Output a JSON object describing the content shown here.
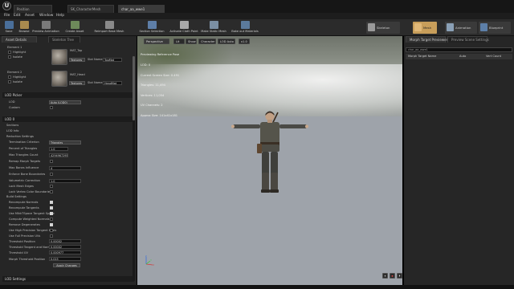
{
  "titlebar": {
    "logo": "U",
    "tabs": [
      "Position",
      "SK_CharacterMesh",
      "char_aa_wwe1"
    ]
  },
  "menu": [
    "File",
    "Edit",
    "Asset",
    "Window",
    "Help"
  ],
  "toolbar": {
    "buttons": [
      "Save",
      "Browse",
      "Preview Animation",
      "Create Asset",
      "Reimport Base Mesh",
      "Section Selection",
      "Activate Cloth Paint",
      "Make Static Mesh",
      "Bake out Materials"
    ],
    "modes": [
      "Skeleton",
      "Mesh",
      "Animation",
      "Blueprint"
    ]
  },
  "left_panel": {
    "tabs": [
      "Asset Details",
      "Skeleton Tree"
    ],
    "element1": {
      "label": "Element 1",
      "material": "MAT_Top",
      "dropdown": "Textures",
      "slot_label": "Slot Name",
      "slot_value": "TopMat",
      "highlight": "Highlight",
      "isolate": "Isolate"
    },
    "element2": {
      "label": "Element 2",
      "material": "MAT_Head",
      "dropdown": "Textures",
      "slot_label": "Slot Name",
      "slot_value": "HeadMat",
      "highlight": "Highlight",
      "isolate": "Isolate"
    },
    "lod_picker": {
      "title": "LOD Picker",
      "lod_label": "LOD",
      "lod_value": "Auto (LOD0)",
      "custom_label": "Custom"
    },
    "lod0": {
      "title": "LOD 0",
      "sections": "Sections",
      "lod_info": "LOD Info"
    },
    "reduction": {
      "title": "Reduction Settings",
      "rows": [
        {
          "label": "Termination Criterion",
          "value": "Triangles"
        },
        {
          "label": "Percent of Triangles",
          "value": "1.0"
        },
        {
          "label": "Max Triangles Count",
          "value": "4294967295"
        },
        {
          "label": "Remap Morph Targets",
          "value": ""
        },
        {
          "label": "Max Bones Influence",
          "value": "4"
        },
        {
          "label": "Enforce Bone Boundaries",
          "value": ""
        },
        {
          "label": "Volumetric Correction",
          "value": "1.0"
        },
        {
          "label": "Lock Mesh Edges",
          "value": ""
        },
        {
          "label": "Lock Vertex Color Boundaries",
          "value": ""
        }
      ]
    },
    "build": {
      "title": "Build Settings",
      "checkbox_rows": [
        "Recompute Normals",
        "Recompute Tangents",
        "Use MikkTSpace Tangent Space",
        "Compute Weighted Normals",
        "Remove Degenerates",
        "Use High Precision Tangent Basis",
        "Use Full Precision UVs"
      ],
      "value_rows": [
        {
          "label": "Threshold Position",
          "value": "0.00002"
        },
        {
          "label": "Threshold Tangent and Normal",
          "value": "0.00002"
        },
        {
          "label": "Threshold UV",
          "value": "0.000977"
        },
        {
          "label": "Morph Threshold Position",
          "value": "0.015"
        }
      ],
      "apply_button": "Apply Changes"
    },
    "lod_settings": "LOD Settings"
  },
  "viewport": {
    "buttons": [
      "Perspective",
      "Lit",
      "Show",
      "Character",
      "LOD Auto",
      "x1.0"
    ],
    "stats": [
      "Previewing Reference Pose",
      "LOD: 0",
      "Current Screen Size: 0.491",
      "Triangles: 11,494",
      "Vertices: 11,054",
      "UV Channels: 2",
      "Approx Size: 141x41x181"
    ],
    "axis_labels": [
      "Z",
      "X",
      "Y"
    ],
    "controls": [
      "⏸",
      "⏹",
      "⏵"
    ]
  },
  "right_panel": {
    "tabs": [
      "Morph Target Previewer",
      "Preview Scene Settings"
    ],
    "search_placeholder": "char_aa_wwe1",
    "columns": [
      "Morph Target Name",
      "Auto",
      "Vert Count"
    ]
  },
  "colors": {
    "accent": "#e28a33",
    "mode_active": "#c89e5a",
    "viewport_floor": "#9ea3aa"
  }
}
